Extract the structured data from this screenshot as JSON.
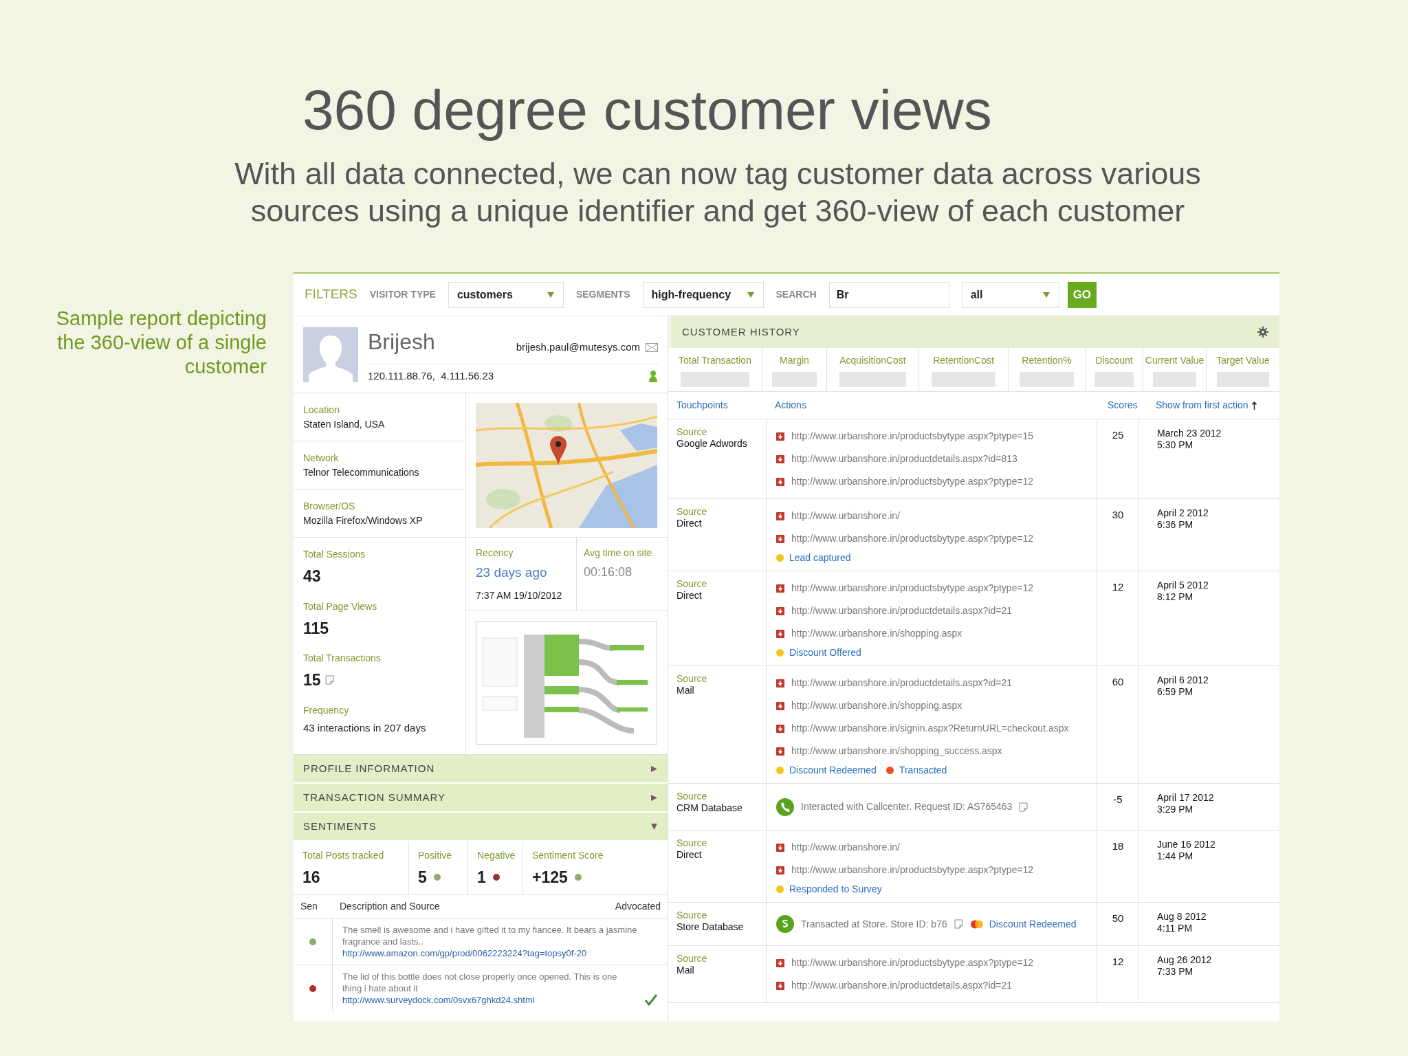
{
  "slide": {
    "title": "360 degree customer views",
    "subtitle_lines": [
      "With all data connected, we can now tag customer data across various",
      "sources using a unique identifier and get 360-view of each customer"
    ],
    "caption": "Sample report depicting the 360-view of a single customer"
  },
  "filters": {
    "title": "FILTERS",
    "fields": [
      {
        "kind": "select",
        "label": "VISITOR TYPE",
        "value": "customers"
      },
      {
        "kind": "select",
        "label": "SEGMENTS",
        "value": "high-frequency"
      },
      {
        "kind": "text",
        "label": "SEARCH",
        "value": "Br"
      },
      {
        "kind": "select",
        "value": "all"
      }
    ],
    "go": "GO"
  },
  "profile": {
    "name": "Brijesh",
    "email": "brijesh.paul@mutesys.com",
    "ips": "120.111.88.76,  4.111.56.23"
  },
  "details": [
    {
      "label": "Location",
      "value": "Staten Island, USA"
    },
    {
      "label": "Network",
      "value": "Telnor Telecommunications"
    },
    {
      "label": "Browser/OS",
      "value": "Mozilla Firefox/Windows XP"
    }
  ],
  "stats": [
    {
      "kind": "number",
      "label": "Total Sessions",
      "value": "43"
    },
    {
      "kind": "number",
      "label": "Total Page Views",
      "value": "115"
    },
    {
      "kind": "number",
      "label": "Total Transactions",
      "value": "15",
      "note_icon": true
    },
    {
      "kind": "text",
      "label": "Frequency",
      "value": "43 interactions in 207 days"
    }
  ],
  "recency": {
    "label": "Recency",
    "value": "23 days ago",
    "detail": "7:37 AM 19/10/2012"
  },
  "avg_time": {
    "label": "Avg time on site",
    "value": "00:16:08"
  },
  "sections": [
    {
      "label": "PROFILE INFORMATION",
      "expanded": false
    },
    {
      "label": "TRANSACTION SUMMARY",
      "expanded": false
    },
    {
      "label": "SENTIMENTS",
      "expanded": true
    }
  ],
  "sentiments": {
    "metrics": [
      {
        "label": "Total Posts tracked",
        "value": "16"
      },
      {
        "label": "Positive",
        "value": "5",
        "color": "#8faa6e"
      },
      {
        "label": "Negative",
        "value": "1",
        "color": "#8b3a3a"
      },
      {
        "label": "Sentiment Score",
        "value": "+125",
        "color": "#8faa6e"
      }
    ],
    "columns": [
      "Sen",
      "Description and Source",
      "Advocated"
    ],
    "posts": [
      {
        "color": "#8faa6e",
        "text": "The smell is awesome and i have gifted it to my fiancee. It bears a jasmine fragrance and lasts..",
        "link": "http://www.amazon.com/gp/prod/0062223224?tag=topsy0f-20",
        "advocated": false
      },
      {
        "color": "#b02a2a",
        "text": "The lid of this bottle does not close properly once opened. This is one thing i hate about it",
        "link": "http://www.surveydock.com/0svx67ghkd24.shtml",
        "advocated": true
      }
    ]
  },
  "history": {
    "title": "CUSTOMER HISTORY",
    "metrics": [
      "Total Transaction",
      "Margin",
      "AcquisitionCost",
      "RetentionCost",
      "Retention%",
      "Discount",
      "Current Value",
      "Target Value"
    ],
    "columns": [
      "Touchpoints",
      "Actions",
      "Scores",
      "Show from first action"
    ],
    "rows": [
      {
        "source_label": "Source",
        "source": "Google Adwords",
        "actions": [
          {
            "kind": "url",
            "text": "http://www.urbanshore.in/productsbytype.aspx?ptype=15"
          },
          {
            "kind": "url",
            "text": "http://www.urbanshore.in/productdetails.aspx?id=813"
          },
          {
            "kind": "url",
            "text": "http://www.urbanshore.in/productsbytype.aspx?ptype=12"
          }
        ],
        "score": "25",
        "date": "March 23 2012",
        "time": "5:30 PM"
      },
      {
        "source_label": "Source",
        "source": "Direct",
        "actions": [
          {
            "kind": "url",
            "text": "http://www.urbanshore.in/"
          },
          {
            "kind": "url",
            "text": "http://www.urbanshore.in/productsbytype.aspx?ptype=12"
          }
        ],
        "events": [
          {
            "kind": "dot",
            "text": "Lead captured",
            "color": "#f5c518"
          }
        ],
        "score": "30",
        "date": "April 2 2012",
        "time": "6:36 PM"
      },
      {
        "source_label": "Source",
        "source": "Direct",
        "actions": [
          {
            "kind": "url",
            "text": "http://www.urbanshore.in/productsbytype.aspx?ptype=12"
          },
          {
            "kind": "url",
            "text": "http://www.urbanshore.in/productdetails.aspx?id=21"
          },
          {
            "kind": "url",
            "text": "http://www.urbanshore.in/shopping.aspx"
          }
        ],
        "events": [
          {
            "kind": "dot",
            "text": "Discount Offered",
            "color": "#f5c518"
          }
        ],
        "score": "12",
        "date": "April 5 2012",
        "time": "8:12 PM"
      },
      {
        "source_label": "Source",
        "source": "Mail",
        "actions": [
          {
            "kind": "url",
            "text": "http://www.urbanshore.in/productdetails.aspx?id=21"
          },
          {
            "kind": "url",
            "text": "http://www.urbanshore.in/shopping.aspx"
          },
          {
            "kind": "url",
            "text": "http://www.urbanshore.in/signin.aspx?ReturnURL=checkout.aspx"
          },
          {
            "kind": "url",
            "text": "http://www.urbanshore.in/shopping_success.aspx"
          }
        ],
        "events": [
          {
            "kind": "dot",
            "text": "Discount Redeemed",
            "color": "#f5c518"
          },
          {
            "kind": "dot",
            "text": "Transacted",
            "color": "#f04e23"
          }
        ],
        "score": "60",
        "date": "April 6 2012",
        "time": "6:59 PM"
      },
      {
        "source_label": "Source",
        "source": "CRM Database",
        "actions": [
          {
            "kind": "call",
            "text": "Interacted with Callcenter. Request ID: AS765463",
            "note_icon": true
          }
        ],
        "score": "-5",
        "date": "April 17 2012",
        "time": "3:29 PM"
      },
      {
        "source_label": "Source",
        "source": "Direct",
        "actions": [
          {
            "kind": "url",
            "text": "http://www.urbanshore.in/"
          },
          {
            "kind": "url",
            "text": "http://www.urbanshore.in/productsbytype.aspx?ptype=12"
          }
        ],
        "events": [
          {
            "kind": "dot",
            "text": "Responded to Survey",
            "color": "#f5c518"
          }
        ],
        "score": "18",
        "date": "June 16 2012",
        "time": "1:44 PM"
      },
      {
        "source_label": "Source",
        "source": "Store Database",
        "actions": [
          {
            "kind": "store",
            "text": "Transacted at Store. Store ID: b76",
            "note_icon": true,
            "events": [
              {
                "kind": "card",
                "text": "Discount Redeemed"
              }
            ]
          }
        ],
        "score": "50",
        "date": "Aug 8 2012",
        "time": "4:11 PM"
      },
      {
        "source_label": "Source",
        "source": "Mail",
        "actions": [
          {
            "kind": "url",
            "text": "http://www.urbanshore.in/productsbytype.aspx?ptype=12"
          },
          {
            "kind": "url",
            "text": "http://www.urbanshore.in/productdetails.aspx?id=21"
          }
        ],
        "score": "12",
        "date": "Aug 26 2012",
        "time": "7:33 PM"
      }
    ]
  }
}
